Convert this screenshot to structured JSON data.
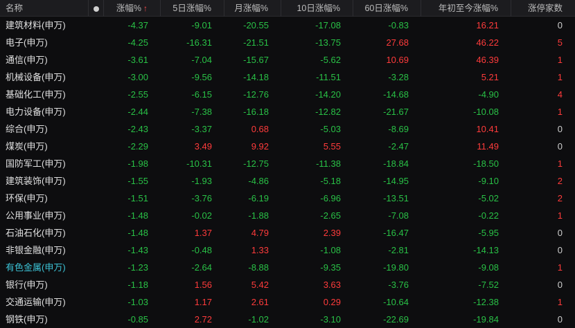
{
  "header": {
    "name": "名称",
    "change_pct": "涨幅%",
    "sort_arrow": "↑",
    "change_5d": "5日涨幅%",
    "change_month": "月涨幅%",
    "change_10d": "10日涨幅%",
    "change_60d": "60日涨幅%",
    "change_ytd": "年初至今涨幅%",
    "limit_up_count": "涨停家数"
  },
  "icons": {
    "column_dot": "circle-dot-icon",
    "sort": "sort-up-arrow-icon"
  },
  "colors": {
    "up": "#ff3b3b",
    "down": "#29c146",
    "link": "#3cc3d6",
    "background": "#0d0d0f"
  },
  "rows": [
    {
      "name": "建筑材料(申万)",
      "chg": "-4.37",
      "d5": "-9.01",
      "m": "-20.55",
      "d10": "-17.08",
      "d60": "-0.83",
      "ytd": "16.21",
      "lu": "0"
    },
    {
      "name": "电子(申万)",
      "chg": "-4.25",
      "d5": "-16.31",
      "m": "-21.51",
      "d10": "-13.75",
      "d60": "27.68",
      "ytd": "46.22",
      "lu": "5"
    },
    {
      "name": "通信(申万)",
      "chg": "-3.61",
      "d5": "-7.04",
      "m": "-15.67",
      "d10": "-5.62",
      "d60": "10.69",
      "ytd": "46.39",
      "lu": "1"
    },
    {
      "name": "机械设备(申万)",
      "chg": "-3.00",
      "d5": "-9.56",
      "m": "-14.18",
      "d10": "-11.51",
      "d60": "-3.28",
      "ytd": "5.21",
      "lu": "1"
    },
    {
      "name": "基础化工(申万)",
      "chg": "-2.55",
      "d5": "-6.15",
      "m": "-12.76",
      "d10": "-14.20",
      "d60": "-14.68",
      "ytd": "-4.90",
      "lu": "4"
    },
    {
      "name": "电力设备(申万)",
      "chg": "-2.44",
      "d5": "-7.38",
      "m": "-16.18",
      "d10": "-12.82",
      "d60": "-21.67",
      "ytd": "-10.08",
      "lu": "1"
    },
    {
      "name": "综合(申万)",
      "chg": "-2.43",
      "d5": "-3.37",
      "m": "0.68",
      "d10": "-5.03",
      "d60": "-8.69",
      "ytd": "10.41",
      "lu": "0"
    },
    {
      "name": "煤炭(申万)",
      "chg": "-2.29",
      "d5": "3.49",
      "m": "9.92",
      "d10": "5.55",
      "d60": "-2.47",
      "ytd": "11.49",
      "lu": "0"
    },
    {
      "name": "国防军工(申万)",
      "chg": "-1.98",
      "d5": "-10.31",
      "m": "-12.75",
      "d10": "-11.38",
      "d60": "-18.84",
      "ytd": "-18.50",
      "lu": "1"
    },
    {
      "name": "建筑装饰(申万)",
      "chg": "-1.55",
      "d5": "-1.93",
      "m": "-4.86",
      "d10": "-5.18",
      "d60": "-14.95",
      "ytd": "-9.10",
      "lu": "2"
    },
    {
      "name": "环保(申万)",
      "chg": "-1.51",
      "d5": "-3.76",
      "m": "-6.19",
      "d10": "-6.96",
      "d60": "-13.51",
      "ytd": "-5.02",
      "lu": "2"
    },
    {
      "name": "公用事业(申万)",
      "chg": "-1.48",
      "d5": "-0.02",
      "m": "-1.88",
      "d10": "-2.65",
      "d60": "-7.08",
      "ytd": "-0.22",
      "lu": "1"
    },
    {
      "name": "石油石化(申万)",
      "chg": "-1.48",
      "d5": "1.37",
      "m": "4.79",
      "d10": "2.39",
      "d60": "-16.47",
      "ytd": "-5.95",
      "lu": "0"
    },
    {
      "name": "非银金融(申万)",
      "chg": "-1.43",
      "d5": "-0.48",
      "m": "1.33",
      "d10": "-1.08",
      "d60": "-2.81",
      "ytd": "-14.13",
      "lu": "0"
    },
    {
      "name": "有色金属(申万)",
      "chg": "-1.23",
      "d5": "-2.64",
      "m": "-8.88",
      "d10": "-9.35",
      "d60": "-19.80",
      "ytd": "-9.08",
      "lu": "1",
      "highlight": true
    },
    {
      "name": "银行(申万)",
      "chg": "-1.18",
      "d5": "1.56",
      "m": "5.42",
      "d10": "3.63",
      "d60": "-3.76",
      "ytd": "-7.52",
      "lu": "0"
    },
    {
      "name": "交通运输(申万)",
      "chg": "-1.03",
      "d5": "1.17",
      "m": "2.61",
      "d10": "0.29",
      "d60": "-10.64",
      "ytd": "-12.38",
      "lu": "1"
    },
    {
      "name": "钢铁(申万)",
      "chg": "-0.85",
      "d5": "2.72",
      "m": "-1.02",
      "d10": "-3.10",
      "d60": "-22.69",
      "ytd": "-19.84",
      "lu": "0"
    }
  ]
}
